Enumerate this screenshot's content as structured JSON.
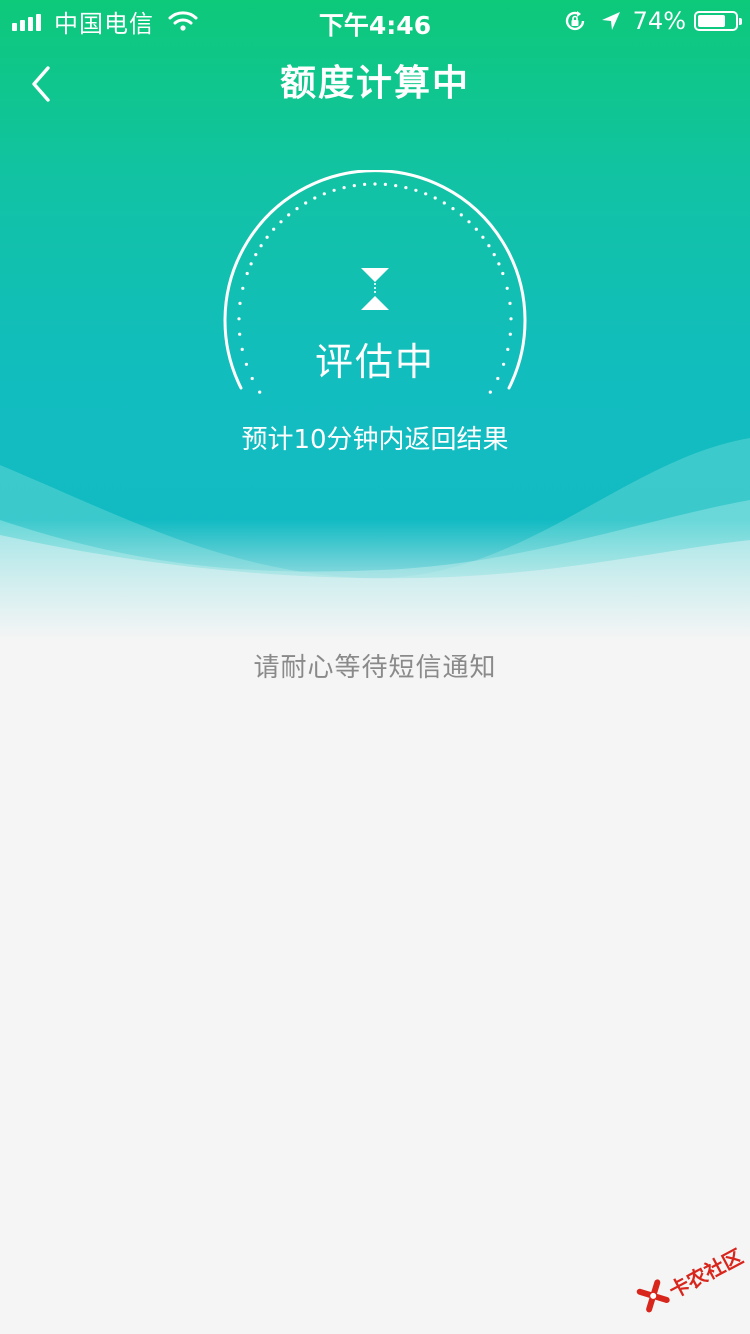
{
  "status_bar": {
    "carrier": "中国电信",
    "time": "下午4:46",
    "battery_percent_label": "74%",
    "battery_level": 0.74
  },
  "nav": {
    "title": "额度计算中"
  },
  "gauge": {
    "status_label": "评估中"
  },
  "eta_text": "预计10分钟内返回结果",
  "notice_text": "请耐心等待短信通知",
  "watermark": {
    "text": "卡农社区"
  },
  "colors": {
    "gradient_top": "#0dc97a",
    "gradient_bottom": "#12b9c6",
    "page_background": "#f5f5f5",
    "notice_text": "#8a8a8a",
    "watermark": "#d8261d"
  },
  "icons": {
    "back": "chevron-left-icon",
    "gauge": "hourglass-icon",
    "wifi": "wifi-icon",
    "orientation_lock": "rotation-lock-icon",
    "location": "location-arrow-icon"
  }
}
